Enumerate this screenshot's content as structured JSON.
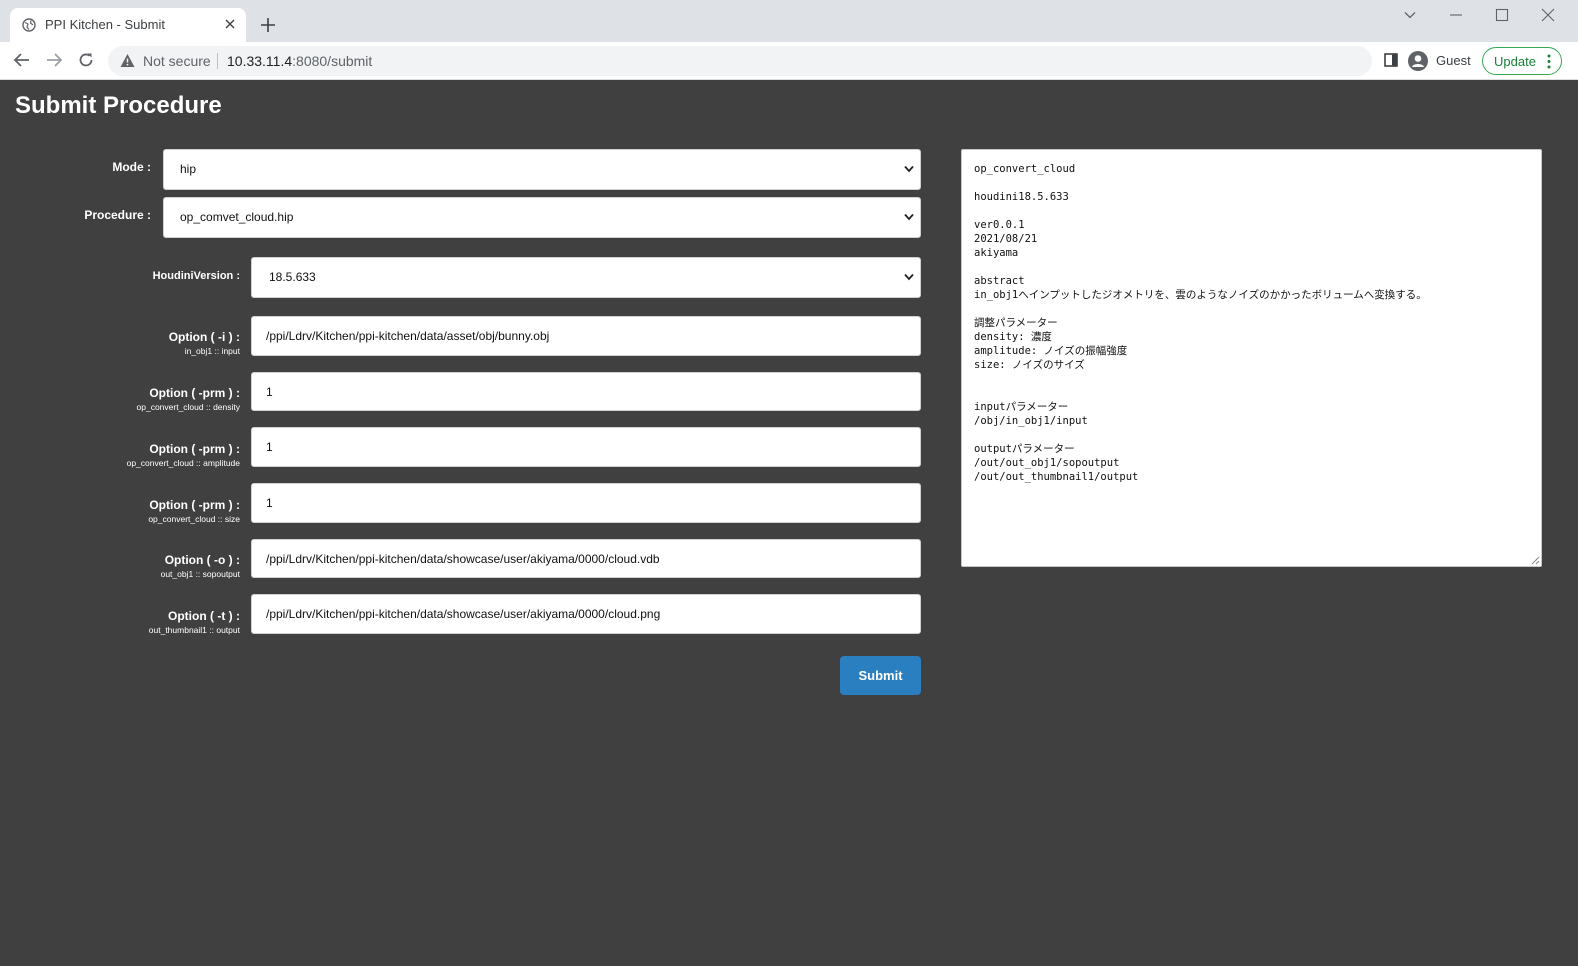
{
  "browser": {
    "tab_title": "PPI Kitchen - Submit",
    "security_label": "Not secure",
    "url_host": "10.33.11.4",
    "url_rest": ":8080/submit",
    "profile_label": "Guest",
    "update_label": "Update"
  },
  "page": {
    "title": "Submit Procedure",
    "submit_label": "Submit"
  },
  "form": {
    "mode": {
      "label": "Mode :",
      "value": "hip"
    },
    "procedure": {
      "label": "Procedure :",
      "value": "op_comvet_cloud.hip"
    },
    "houdini_version": {
      "label": "HoudiniVersion :",
      "value": "18.5.633"
    },
    "options": [
      {
        "label": "Option ( -i ) :",
        "sublabel": "in_obj1 :: input",
        "value": "/ppi/Ldrv/Kitchen/ppi-kitchen/data/asset/obj/bunny.obj"
      },
      {
        "label": "Option ( -prm ) :",
        "sublabel": "op_convert_cloud :: density",
        "value": "1"
      },
      {
        "label": "Option ( -prm ) :",
        "sublabel": "op_convert_cloud :: amplitude",
        "value": "1"
      },
      {
        "label": "Option ( -prm ) :",
        "sublabel": "op_convert_cloud :: size",
        "value": "1"
      },
      {
        "label": "Option ( -o ) :",
        "sublabel": "out_obj1 :: sopoutput",
        "value": "/ppi/Ldrv/Kitchen/ppi-kitchen/data/showcase/user/akiyama/0000/cloud.vdb"
      },
      {
        "label": "Option ( -t ) :",
        "sublabel": "out_thumbnail1 :: output",
        "value": "/ppi/Ldrv/Kitchen/ppi-kitchen/data/showcase/user/akiyama/0000/cloud.png"
      }
    ]
  },
  "description": "op_convert_cloud\n\nhoudini18.5.633\n\nver0.0.1\n2021/08/21\nakiyama\n\nabstract\nin_obj1へインプットしたジオメトリを、雲のようなノイズのかかったボリュームへ変換する。\n\n調整パラメーター\ndensity: 濃度\namplitude: ノイズの振幅強度\nsize: ノイズのサイズ\n\n\ninputパラメーター\n/obj/in_obj1/input\n\noutputパラメーター\n/out/out_obj1/sopoutput\n/out/out_thumbnail1/output"
}
